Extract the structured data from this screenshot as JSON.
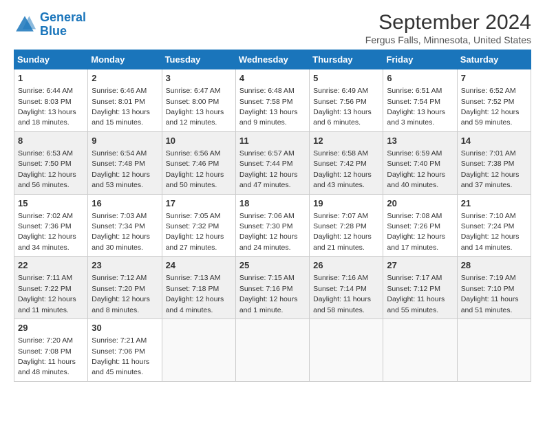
{
  "logo": {
    "line1": "General",
    "line2": "Blue"
  },
  "title": "September 2024",
  "subtitle": "Fergus Falls, Minnesota, United States",
  "weekdays": [
    "Sunday",
    "Monday",
    "Tuesday",
    "Wednesday",
    "Thursday",
    "Friday",
    "Saturday"
  ],
  "weeks": [
    [
      {
        "day": "1",
        "sunrise": "Sunrise: 6:44 AM",
        "sunset": "Sunset: 8:03 PM",
        "daylight": "Daylight: 13 hours and 18 minutes."
      },
      {
        "day": "2",
        "sunrise": "Sunrise: 6:46 AM",
        "sunset": "Sunset: 8:01 PM",
        "daylight": "Daylight: 13 hours and 15 minutes."
      },
      {
        "day": "3",
        "sunrise": "Sunrise: 6:47 AM",
        "sunset": "Sunset: 8:00 PM",
        "daylight": "Daylight: 13 hours and 12 minutes."
      },
      {
        "day": "4",
        "sunrise": "Sunrise: 6:48 AM",
        "sunset": "Sunset: 7:58 PM",
        "daylight": "Daylight: 13 hours and 9 minutes."
      },
      {
        "day": "5",
        "sunrise": "Sunrise: 6:49 AM",
        "sunset": "Sunset: 7:56 PM",
        "daylight": "Daylight: 13 hours and 6 minutes."
      },
      {
        "day": "6",
        "sunrise": "Sunrise: 6:51 AM",
        "sunset": "Sunset: 7:54 PM",
        "daylight": "Daylight: 13 hours and 3 minutes."
      },
      {
        "day": "7",
        "sunrise": "Sunrise: 6:52 AM",
        "sunset": "Sunset: 7:52 PM",
        "daylight": "Daylight: 12 hours and 59 minutes."
      }
    ],
    [
      {
        "day": "8",
        "sunrise": "Sunrise: 6:53 AM",
        "sunset": "Sunset: 7:50 PM",
        "daylight": "Daylight: 12 hours and 56 minutes."
      },
      {
        "day": "9",
        "sunrise": "Sunrise: 6:54 AM",
        "sunset": "Sunset: 7:48 PM",
        "daylight": "Daylight: 12 hours and 53 minutes."
      },
      {
        "day": "10",
        "sunrise": "Sunrise: 6:56 AM",
        "sunset": "Sunset: 7:46 PM",
        "daylight": "Daylight: 12 hours and 50 minutes."
      },
      {
        "day": "11",
        "sunrise": "Sunrise: 6:57 AM",
        "sunset": "Sunset: 7:44 PM",
        "daylight": "Daylight: 12 hours and 47 minutes."
      },
      {
        "day": "12",
        "sunrise": "Sunrise: 6:58 AM",
        "sunset": "Sunset: 7:42 PM",
        "daylight": "Daylight: 12 hours and 43 minutes."
      },
      {
        "day": "13",
        "sunrise": "Sunrise: 6:59 AM",
        "sunset": "Sunset: 7:40 PM",
        "daylight": "Daylight: 12 hours and 40 minutes."
      },
      {
        "day": "14",
        "sunrise": "Sunrise: 7:01 AM",
        "sunset": "Sunset: 7:38 PM",
        "daylight": "Daylight: 12 hours and 37 minutes."
      }
    ],
    [
      {
        "day": "15",
        "sunrise": "Sunrise: 7:02 AM",
        "sunset": "Sunset: 7:36 PM",
        "daylight": "Daylight: 12 hours and 34 minutes."
      },
      {
        "day": "16",
        "sunrise": "Sunrise: 7:03 AM",
        "sunset": "Sunset: 7:34 PM",
        "daylight": "Daylight: 12 hours and 30 minutes."
      },
      {
        "day": "17",
        "sunrise": "Sunrise: 7:05 AM",
        "sunset": "Sunset: 7:32 PM",
        "daylight": "Daylight: 12 hours and 27 minutes."
      },
      {
        "day": "18",
        "sunrise": "Sunrise: 7:06 AM",
        "sunset": "Sunset: 7:30 PM",
        "daylight": "Daylight: 12 hours and 24 minutes."
      },
      {
        "day": "19",
        "sunrise": "Sunrise: 7:07 AM",
        "sunset": "Sunset: 7:28 PM",
        "daylight": "Daylight: 12 hours and 21 minutes."
      },
      {
        "day": "20",
        "sunrise": "Sunrise: 7:08 AM",
        "sunset": "Sunset: 7:26 PM",
        "daylight": "Daylight: 12 hours and 17 minutes."
      },
      {
        "day": "21",
        "sunrise": "Sunrise: 7:10 AM",
        "sunset": "Sunset: 7:24 PM",
        "daylight": "Daylight: 12 hours and 14 minutes."
      }
    ],
    [
      {
        "day": "22",
        "sunrise": "Sunrise: 7:11 AM",
        "sunset": "Sunset: 7:22 PM",
        "daylight": "Daylight: 12 hours and 11 minutes."
      },
      {
        "day": "23",
        "sunrise": "Sunrise: 7:12 AM",
        "sunset": "Sunset: 7:20 PM",
        "daylight": "Daylight: 12 hours and 8 minutes."
      },
      {
        "day": "24",
        "sunrise": "Sunrise: 7:13 AM",
        "sunset": "Sunset: 7:18 PM",
        "daylight": "Daylight: 12 hours and 4 minutes."
      },
      {
        "day": "25",
        "sunrise": "Sunrise: 7:15 AM",
        "sunset": "Sunset: 7:16 PM",
        "daylight": "Daylight: 12 hours and 1 minute."
      },
      {
        "day": "26",
        "sunrise": "Sunrise: 7:16 AM",
        "sunset": "Sunset: 7:14 PM",
        "daylight": "Daylight: 11 hours and 58 minutes."
      },
      {
        "day": "27",
        "sunrise": "Sunrise: 7:17 AM",
        "sunset": "Sunset: 7:12 PM",
        "daylight": "Daylight: 11 hours and 55 minutes."
      },
      {
        "day": "28",
        "sunrise": "Sunrise: 7:19 AM",
        "sunset": "Sunset: 7:10 PM",
        "daylight": "Daylight: 11 hours and 51 minutes."
      }
    ],
    [
      {
        "day": "29",
        "sunrise": "Sunrise: 7:20 AM",
        "sunset": "Sunset: 7:08 PM",
        "daylight": "Daylight: 11 hours and 48 minutes."
      },
      {
        "day": "30",
        "sunrise": "Sunrise: 7:21 AM",
        "sunset": "Sunset: 7:06 PM",
        "daylight": "Daylight: 11 hours and 45 minutes."
      },
      null,
      null,
      null,
      null,
      null
    ]
  ]
}
